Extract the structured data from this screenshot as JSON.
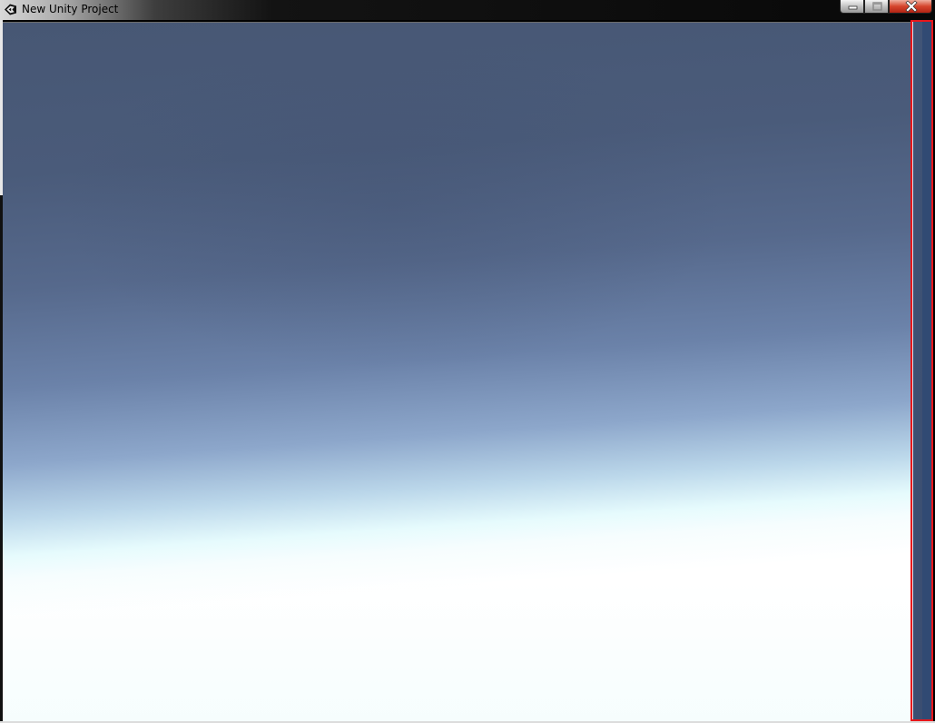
{
  "window": {
    "title": "New Unity Project",
    "icon": "unity-logo-icon",
    "controls": {
      "minimize_icon": "minimize-icon",
      "maximize_icon": "maximize-icon",
      "close_icon": "close-icon",
      "close_color": "#c8321e"
    }
  },
  "viewport": {
    "content": "game-view-skybox",
    "sky_top_color": "#475774",
    "horizon_color": "#e6fbfd",
    "ground_color": "#ffffff"
  },
  "side_panel": {
    "color": "#3d5072",
    "highlight_color": "#e8161b"
  }
}
